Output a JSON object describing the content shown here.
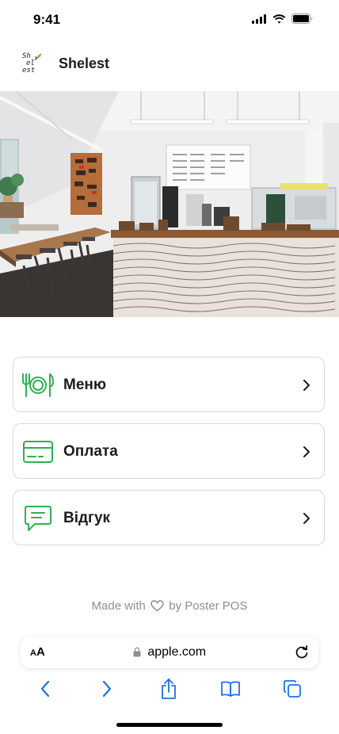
{
  "status_bar": {
    "time": "9:41"
  },
  "header": {
    "logo_text": [
      "Sh",
      "el",
      "est"
    ],
    "brand_name": "Shelest"
  },
  "menu": {
    "items": [
      {
        "label": "Меню",
        "icon": "plate-fork-knife-icon"
      },
      {
        "label": "Оплата",
        "icon": "credit-card-icon"
      },
      {
        "label": "Відгук",
        "icon": "chat-bubble-icon"
      }
    ]
  },
  "footer": {
    "made_with": "Made with",
    "by": "by Poster POS"
  },
  "browser": {
    "aa_large": "A",
    "aa_small": "A",
    "url": "apple.com"
  },
  "colors": {
    "accent_green": "#2fb04f",
    "ios_blue": "#1a73e8",
    "border": "#d9d9dc",
    "muted_text": "#8e8e93"
  }
}
